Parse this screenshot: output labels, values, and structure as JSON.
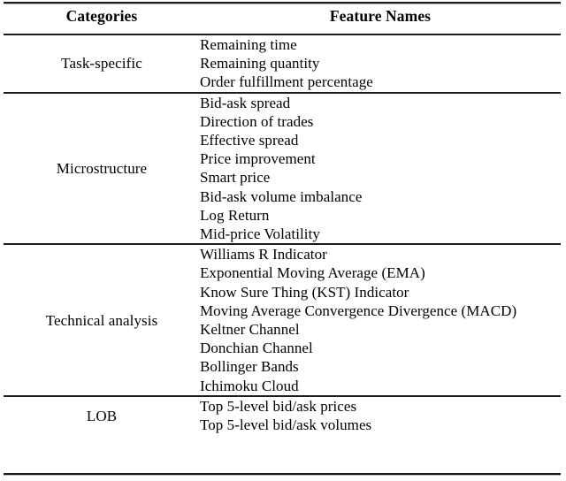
{
  "table": {
    "headers": {
      "categories": "Categories",
      "features": "Feature Names"
    },
    "sections": [
      {
        "category": "Task-specific",
        "features": [
          "Remaining time",
          "Remaining quantity",
          "Order fulfillment percentage"
        ]
      },
      {
        "category": "Microstructure",
        "features": [
          "Bid-ask spread",
          "Direction of trades",
          "Effective spread",
          "Price improvement",
          "Smart price",
          "Bid-ask volume imbalance",
          "Log Return",
          "Mid-price Volatility"
        ]
      },
      {
        "category": "Technical analysis",
        "features": [
          "Williams R Indicator",
          "Exponential Moving Average (EMA)",
          "Know Sure Thing (KST) Indicator",
          "Moving Average Convergence Divergence (MACD)",
          "Keltner Channel",
          "Donchian Channel",
          "Bollinger Bands",
          "Ichimoku Cloud"
        ]
      },
      {
        "category": "LOB",
        "features": [
          "Top 5-level bid/ask prices",
          "Top 5-level bid/ask volumes"
        ]
      }
    ]
  },
  "colors": {
    "rule": "#1c1c1c",
    "text": "#000000",
    "background": "#ffffff"
  }
}
